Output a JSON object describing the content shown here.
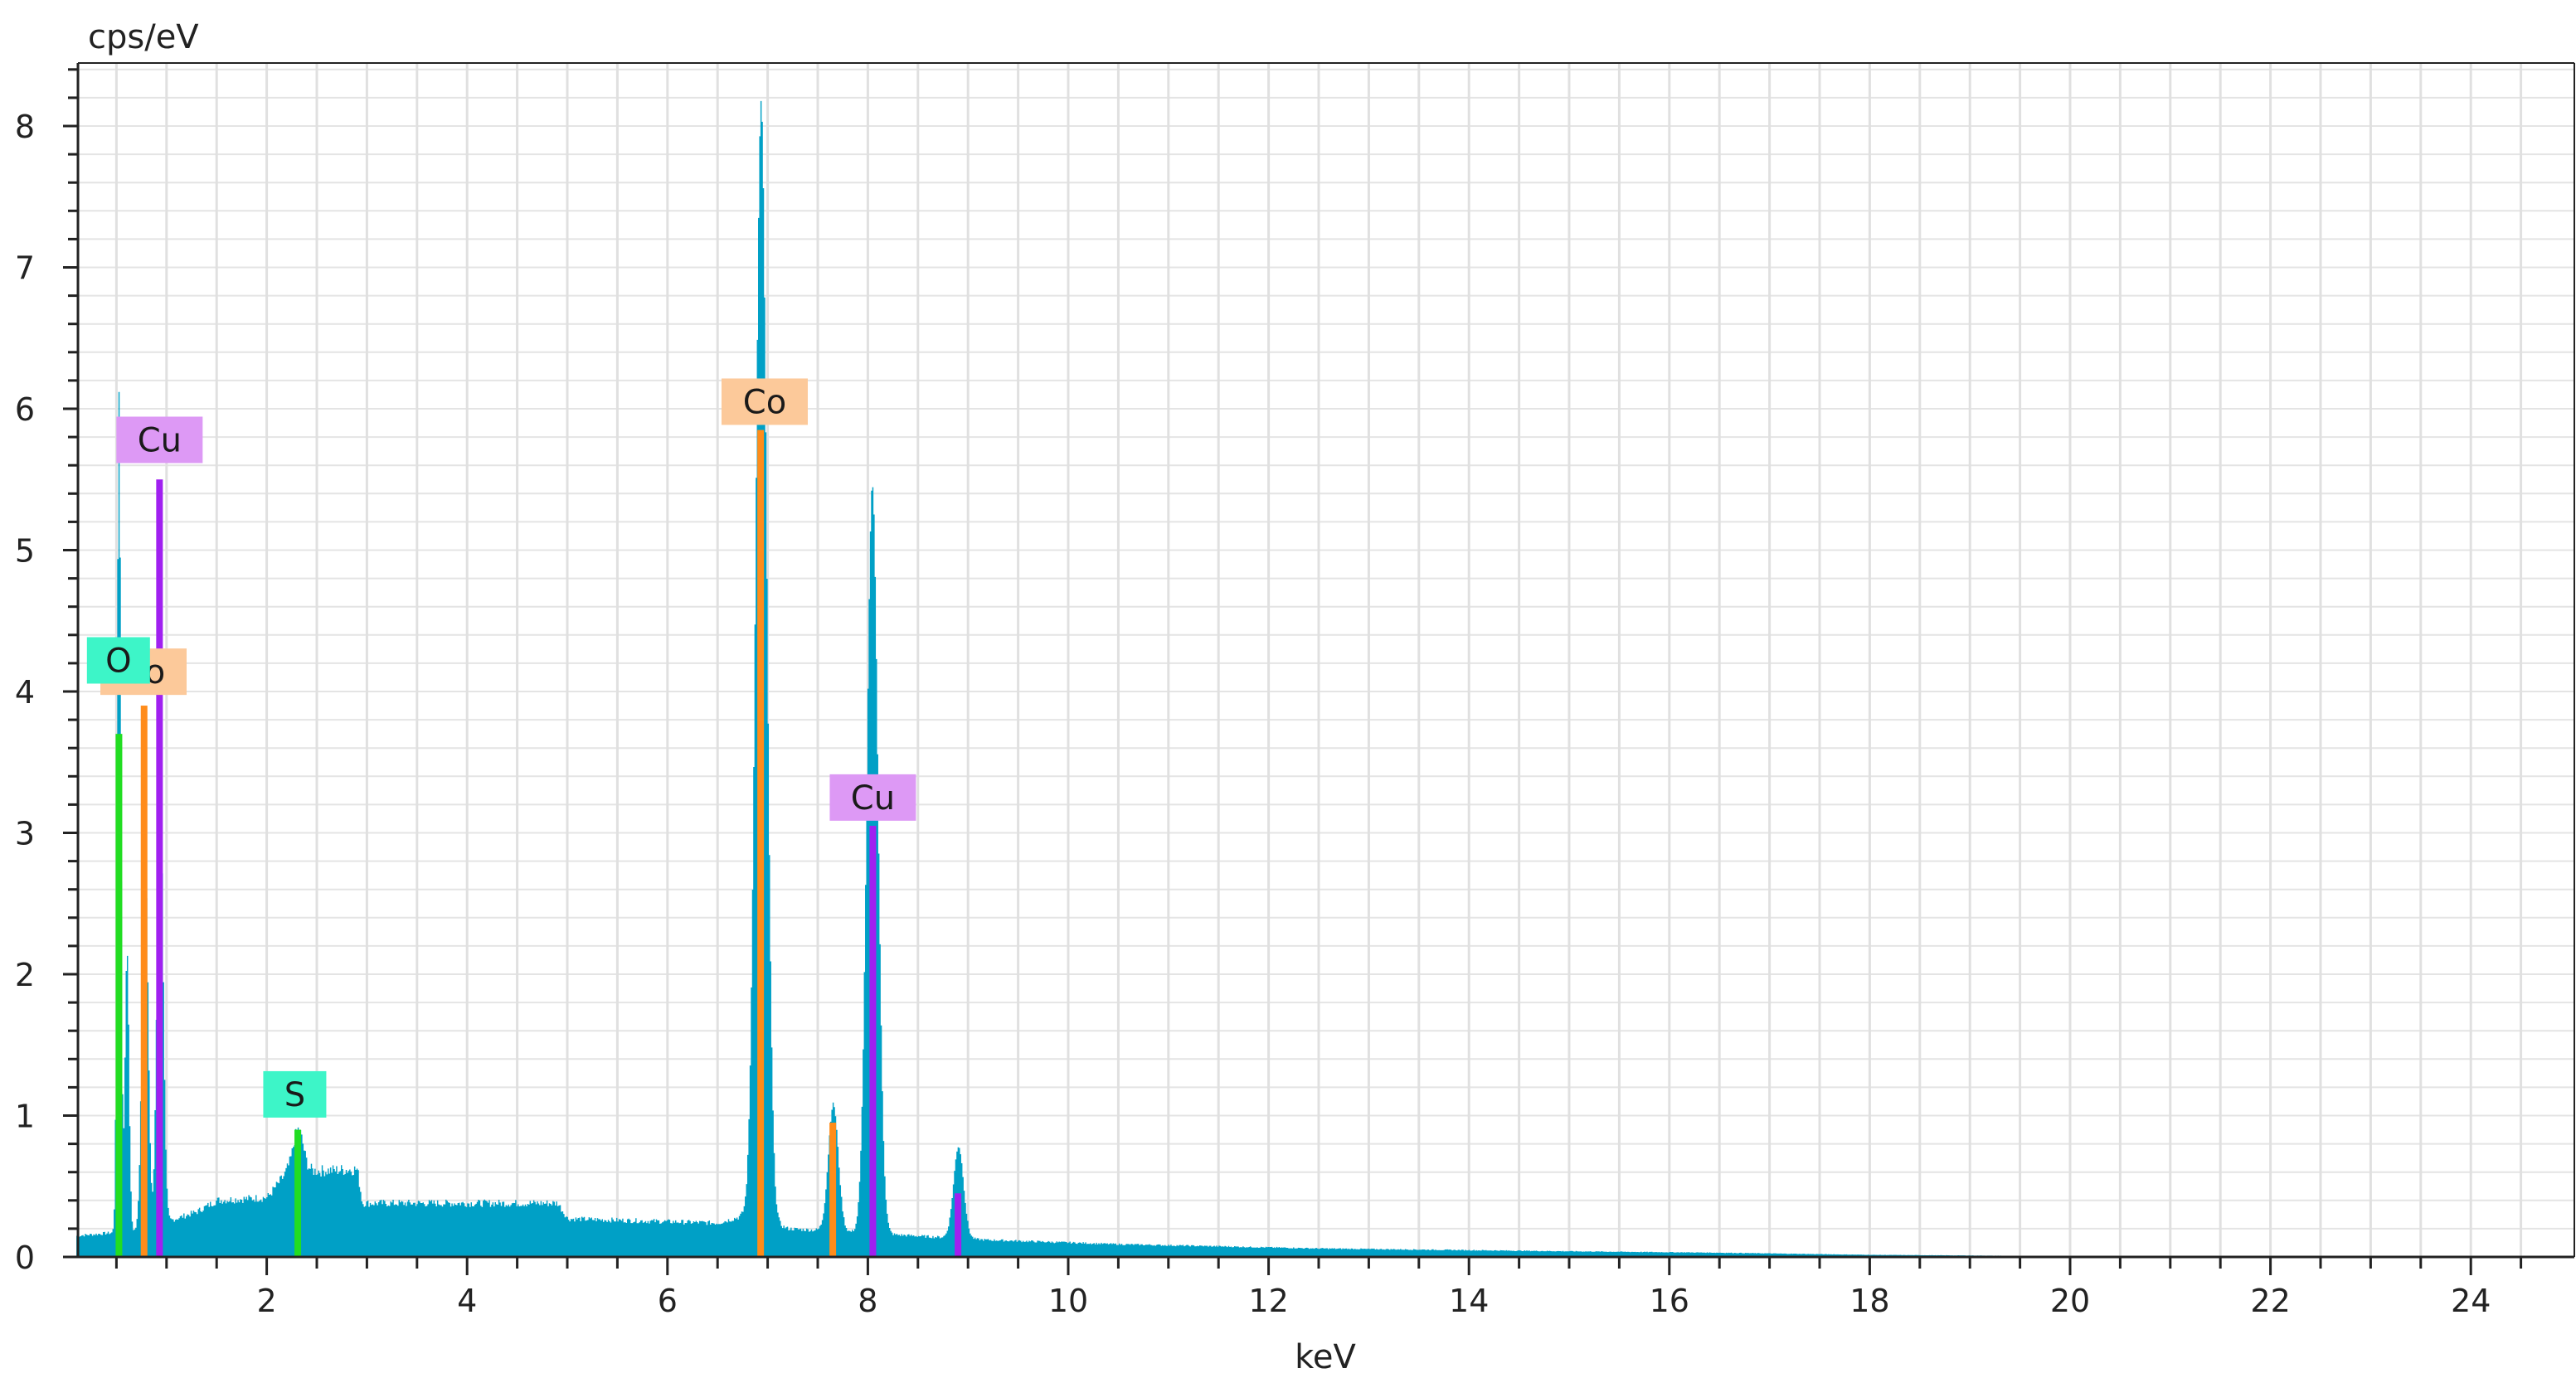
{
  "chart_data": {
    "type": "area",
    "title": "",
    "xlabel": "keV",
    "ylabel": "cps/eV",
    "xlim": [
      0.1,
      25.0
    ],
    "ylim": [
      0,
      8.45
    ],
    "x_ticks": [
      2,
      4,
      6,
      8,
      10,
      12,
      14,
      16,
      18,
      20,
      22,
      24
    ],
    "y_ticks": [
      0,
      1,
      2,
      3,
      4,
      5,
      6,
      7,
      8
    ],
    "grid": true,
    "spectrum_color": "#00a0c6",
    "background": [
      [
        0.1,
        0.15
      ],
      [
        0.95,
        0.2
      ],
      [
        1.0,
        0.25
      ],
      [
        1.3,
        0.32
      ],
      [
        1.5,
        0.4
      ],
      [
        2.0,
        0.42
      ],
      [
        2.2,
        0.6
      ],
      [
        2.9,
        0.62
      ],
      [
        2.95,
        0.38
      ],
      [
        4.9,
        0.38
      ],
      [
        5.0,
        0.27
      ],
      [
        6.5,
        0.24
      ],
      [
        6.8,
        0.3
      ],
      [
        7.2,
        0.2
      ],
      [
        9.2,
        0.12
      ],
      [
        10.5,
        0.09
      ],
      [
        12.5,
        0.06
      ],
      [
        15,
        0.04
      ],
      [
        16.5,
        0.03
      ],
      [
        18,
        0.015
      ],
      [
        19.5,
        0.008
      ],
      [
        21,
        0.0
      ],
      [
        25,
        0.0
      ]
    ],
    "peaks": [
      {
        "energy": 0.52,
        "height": 5.95,
        "sigma": 0.018
      },
      {
        "energy": 0.6,
        "height": 2.0,
        "sigma": 0.02
      },
      {
        "energy": 0.78,
        "height": 2.7,
        "sigma": 0.03
      },
      {
        "energy": 0.93,
        "height": 3.3,
        "sigma": 0.03
      },
      {
        "energy": 2.31,
        "height": 0.3,
        "sigma": 0.05
      },
      {
        "energy": 6.93,
        "height": 7.9,
        "sigma": 0.055
      },
      {
        "energy": 7.65,
        "height": 0.9,
        "sigma": 0.05
      },
      {
        "energy": 8.04,
        "height": 5.3,
        "sigma": 0.055
      },
      {
        "energy": 8.9,
        "height": 0.65,
        "sigma": 0.05
      }
    ],
    "element_lines": [
      {
        "element": "O",
        "energy": 0.525,
        "height": 3.7,
        "color": "#22dd22"
      },
      {
        "element": "Co",
        "energy": 0.776,
        "height": 3.9,
        "color": "#ff8c1a"
      },
      {
        "element": "Cu",
        "energy": 0.93,
        "height": 5.5,
        "color": "#a020f0"
      },
      {
        "element": "S",
        "energy": 2.31,
        "height": 0.9,
        "color": "#22dd22"
      },
      {
        "element": "Co",
        "energy": 6.93,
        "height": 5.85,
        "color": "#ff8c1a"
      },
      {
        "element": "Co",
        "energy": 7.65,
        "height": 0.95,
        "color": "#ff8c1a"
      },
      {
        "element": "Cu",
        "energy": 8.05,
        "height": 3.05,
        "color": "#a020f0"
      },
      {
        "element": "Cu",
        "energy": 8.9,
        "height": 0.45,
        "color": "#a020f0"
      }
    ],
    "labels": [
      {
        "text": "Cu",
        "energy": 0.93,
        "cps": 5.78,
        "color": "#dd99f5"
      },
      {
        "text": "Co",
        "energy": 0.77,
        "cps": 4.14,
        "color": "#fcc99a"
      },
      {
        "text": "O",
        "energy": 0.52,
        "cps": 4.22,
        "color": "#3df5c8"
      },
      {
        "text": "S",
        "energy": 2.28,
        "cps": 1.15,
        "color": "#3df5c8"
      },
      {
        "text": "Co",
        "energy": 6.97,
        "cps": 6.05,
        "color": "#fcc99a"
      },
      {
        "text": "Cu",
        "energy": 8.05,
        "cps": 3.25,
        "color": "#dd99f5"
      }
    ]
  }
}
